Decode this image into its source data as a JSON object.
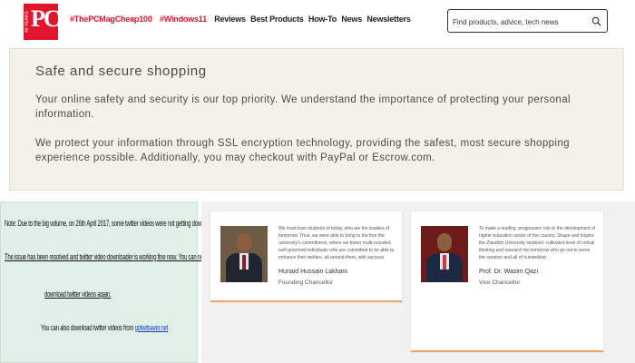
{
  "header": {
    "logo": {
      "badge": "40 YEARS",
      "text": "PC"
    },
    "nav": {
      "tag1": "#ThePCMagCheap100",
      "tag2": "#Windows11",
      "links": [
        "Reviews",
        "Best Products",
        "How-To",
        "News",
        "Newsletters"
      ]
    },
    "search": {
      "placeholder": "Find products, advice, tech news",
      "icon": "search-icon"
    }
  },
  "safe": {
    "title": "Safe and secure shopping",
    "p1": "Your online safety and security is our top priority. We understand the importance of protecting your personal information.",
    "p2": "We protect your information through SSL encryption technology, providing the safest, most secure shopping experience possible. Additionally, you may checkout with PayPal or Escrow.com."
  },
  "note": {
    "line1": "Note: Due to the big volume, on 26th April 2017, some twitter videos were not getting downloaded.",
    "line2": "The issue has been resolved and twitter video downloader is working fine now. You can now",
    "line3": "download twitter videos again.",
    "line4_prefix": "You can also download twitter videos from",
    "line4_link": "gotwitsaver.net"
  },
  "cards": [
    {
      "text": "We must train students of today, who are the leaders of tomorrow. Thus, we were able to bring to the fore the university's commitment, where we foster multi-rounded, well-groomed individuals who are committed to be able to enhance their welfare, all around them, with success.",
      "name": "Hunaid Hussain Lakhani",
      "role": "Founding Chancellor"
    },
    {
      "text": "To make a leading, progressive role in the development of higher education sector of the country. Shape and Inspire the Ziauddin University students' cultivated level of critical thinking and research for tomorrow who go out to serve the creation and all of humankind.",
      "name": "Prof. Dr. Wasim Qazi",
      "role": "Vice Chancellor"
    }
  ],
  "colors": {
    "brand_red": "#e3132b",
    "panel_bg": "#f4f2e8",
    "note_bg": "#dff1e6",
    "card_accent": "#f0a36b",
    "link_blue": "#1a3dbd"
  }
}
